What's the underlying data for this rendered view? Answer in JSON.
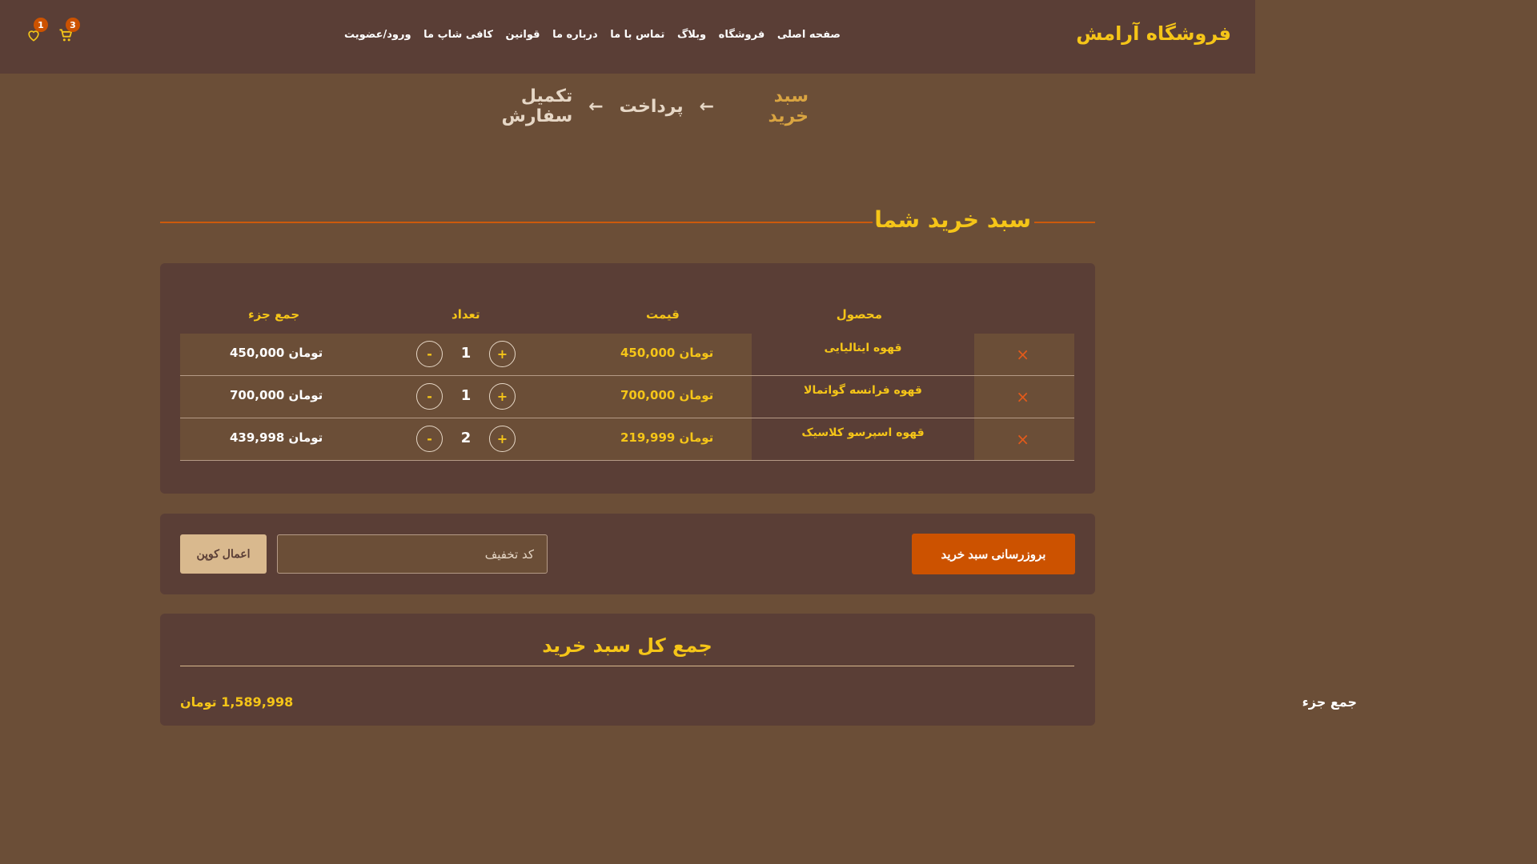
{
  "header": {
    "brand": "فروشگاه آرامش",
    "nav": [
      {
        "label": "صفحه اصلی"
      },
      {
        "label": "فروشگاه"
      },
      {
        "label": "وبلاگ"
      },
      {
        "label": "تماس با ما"
      },
      {
        "label": "درباره ما"
      },
      {
        "label": "قوانین"
      },
      {
        "label": "کافی شاپ ما"
      },
      {
        "label": "ورود/عضویت"
      }
    ],
    "cart_count": "3",
    "wishlist_count": "1"
  },
  "steps": {
    "cart": "سبد خرید",
    "payment": "پرداخت",
    "complete": "تکمیل سفارش",
    "arrow": "←"
  },
  "cart": {
    "title": "سبد خرید شما",
    "columns": {
      "product": "محصول",
      "price": "قیمت",
      "quantity": "تعداد",
      "subtotal": "جمع جزء"
    },
    "remove_symbol": "×",
    "plus": "+",
    "minus": "-",
    "items": [
      {
        "name": "قهوه ایتالیایی",
        "price": "تومان 450,000",
        "qty": "1",
        "subtotal": "تومان 450,000"
      },
      {
        "name": "قهوه فرانسه گواتمالا",
        "price": "تومان 700,000",
        "qty": "1",
        "subtotal": "تومان 700,000"
      },
      {
        "name": "قهوه اسپرسو کلاسیک",
        "price": "تومان 219,999",
        "qty": "2",
        "subtotal": "تومان 439,998"
      }
    ]
  },
  "coupon": {
    "update_label": "بروزرسانی سبد خرید",
    "placeholder": "کد تخفیف",
    "apply_label": "اعمال کوپن"
  },
  "totals": {
    "title": "جمع کل سبد خرید",
    "subtotal_label": "جمع جزء",
    "subtotal_value": "1,589,998 تومان"
  },
  "colors": {
    "accent": "#f5c518",
    "orange": "#cc5200",
    "header_bg": "#5a3e36",
    "page_bg": "#6b4e37"
  }
}
